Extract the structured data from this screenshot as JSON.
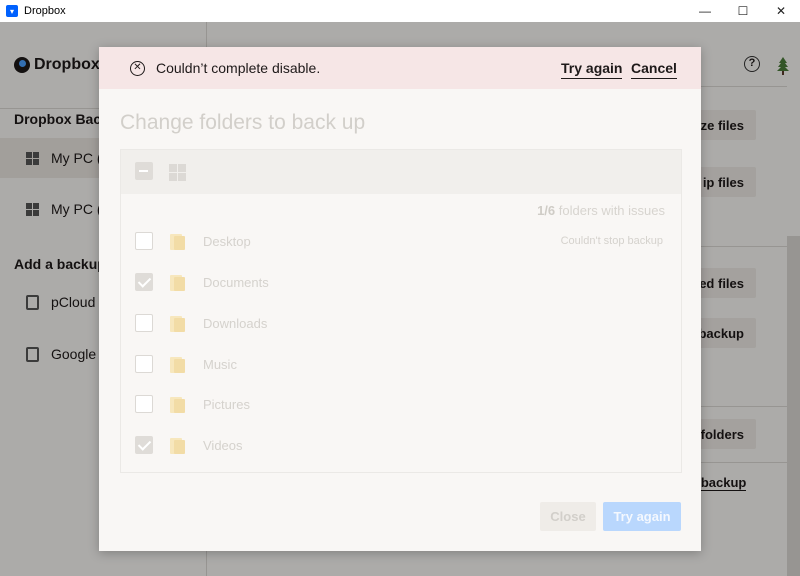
{
  "window": {
    "title": "Dropbox",
    "minimize": "—",
    "maximize": "☐",
    "close": "✕"
  },
  "app": {
    "logo_text": "Dropbox",
    "sidebar": {
      "backups_heading": "Dropbox Back",
      "items": [
        {
          "label": "My PC (",
          "icon": "windows-icon",
          "active": true
        },
        {
          "label": "My PC (",
          "icon": "windows-icon",
          "active": false
        }
      ],
      "add_backup_heading": "Add a backup",
      "add_items": [
        {
          "label": "pCloud",
          "icon": "device-icon"
        },
        {
          "label": "Google",
          "icon": "device-icon"
        }
      ]
    },
    "right_buttons": [
      "ze files",
      "ip files",
      "ed files",
      "backup",
      "folders"
    ],
    "right_link": "e backup",
    "help_icon": "?"
  },
  "modal": {
    "banner": {
      "icon": "error-circle-icon",
      "message": "Couldn’t complete disable.",
      "try_again": "Try again",
      "cancel": "Cancel",
      "background": "#f6e6e6"
    },
    "title": "Change folders to back up",
    "issues": {
      "count": "1/6",
      "label": "folders with issues"
    },
    "folders": [
      {
        "name": "Desktop",
        "checked": false,
        "status": "Couldn't stop backup"
      },
      {
        "name": "Documents",
        "checked": true,
        "status": ""
      },
      {
        "name": "Downloads",
        "checked": false,
        "status": ""
      },
      {
        "name": "Music",
        "checked": false,
        "status": ""
      },
      {
        "name": "Pictures",
        "checked": false,
        "status": ""
      },
      {
        "name": "Videos",
        "checked": true,
        "status": ""
      }
    ],
    "buttons": {
      "close": "Close",
      "try_again": "Try again"
    },
    "accent": "#0061fe"
  }
}
